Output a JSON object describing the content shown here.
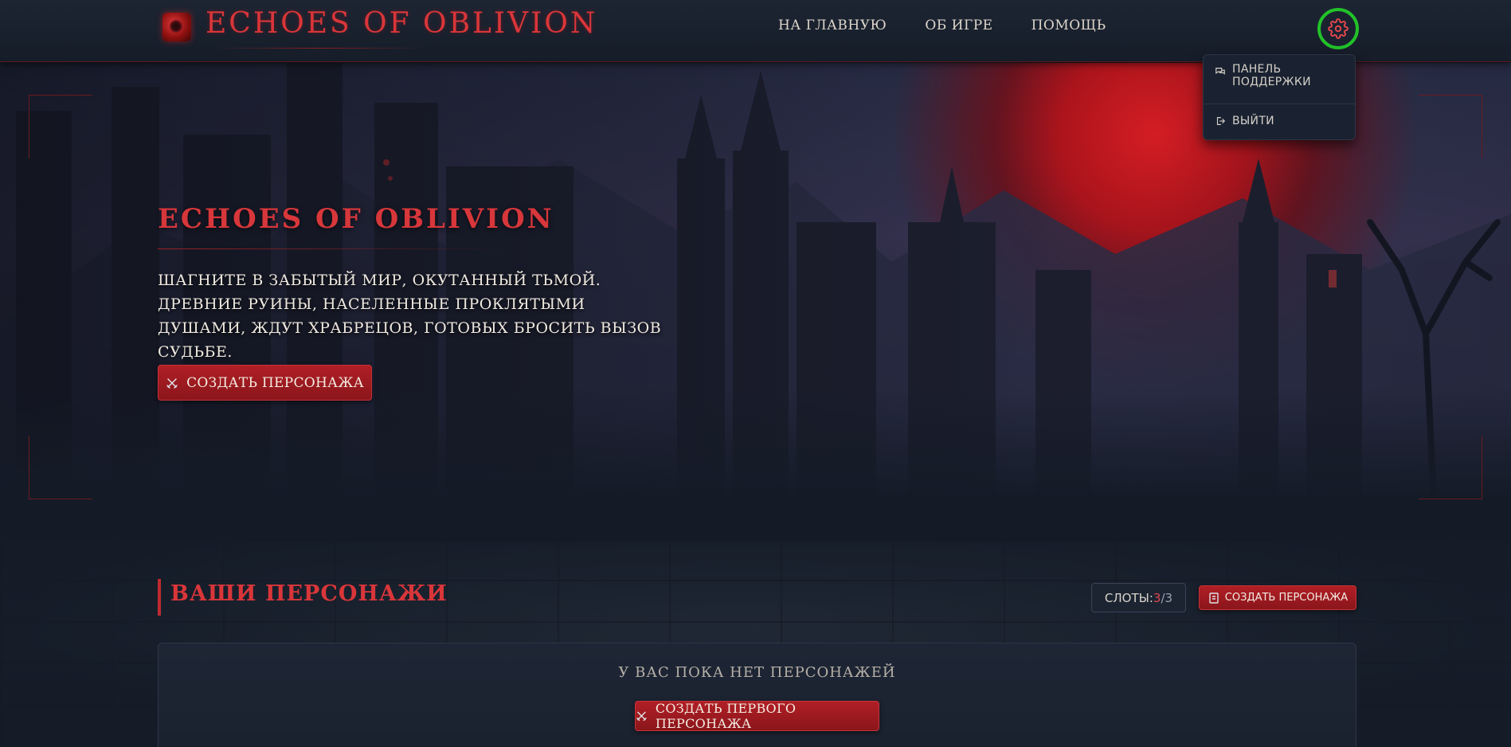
{
  "header": {
    "brand": "ECHOES OF OBLIVION",
    "nav": [
      {
        "label": "НА ГЛАВНУЮ"
      },
      {
        "label": "ОБ ИГРЕ"
      },
      {
        "label": "ПОМОЩЬ"
      }
    ],
    "settings_icon": "gear-icon"
  },
  "dropdown": {
    "items": [
      {
        "label_line1": "ПАНЕЛЬ",
        "label_line2": "ПОДДЕРЖКИ",
        "icon": "chat-icon"
      },
      {
        "label": "ВЫЙТИ",
        "icon": "logout-icon"
      }
    ]
  },
  "hero": {
    "title": "ECHOES OF OBLIVION",
    "description": "ШАГНИТЕ В ЗАБЫТЫЙ МИР, ОКУТАННЫЙ ТЬМОЙ. ДРЕВНИЕ РУИНЫ, НАСЕЛЕННЫЕ ПРОКЛЯТЫМИ ДУШАМИ, ЖДУТ ХРАБРЕЦОВ, ГОТОВЫХ БРОСИТЬ ВЫЗОВ СУДЬБЕ.",
    "cta": "СОЗДАТЬ ПЕРСОНАЖА"
  },
  "characters": {
    "title": "ВАШИ ПЕРСОНАЖИ",
    "slots_label": "СЛОТЫ: ",
    "slots_used": "3",
    "slots_sep": "/",
    "slots_total": "3",
    "create_button": "СОЗДАТЬ ПЕРСОНАЖА",
    "empty_text": "У ВАС ПОКА НЕТ ПЕРСОНАЖЕЙ",
    "create_first_button": "СОЗДАТЬ ПЕРВОГО ПЕРСОНАЖА"
  },
  "colors": {
    "accent": "#d9363a",
    "button": "#a01c22",
    "background": "#141b27",
    "focus_ring": "#22c229"
  }
}
